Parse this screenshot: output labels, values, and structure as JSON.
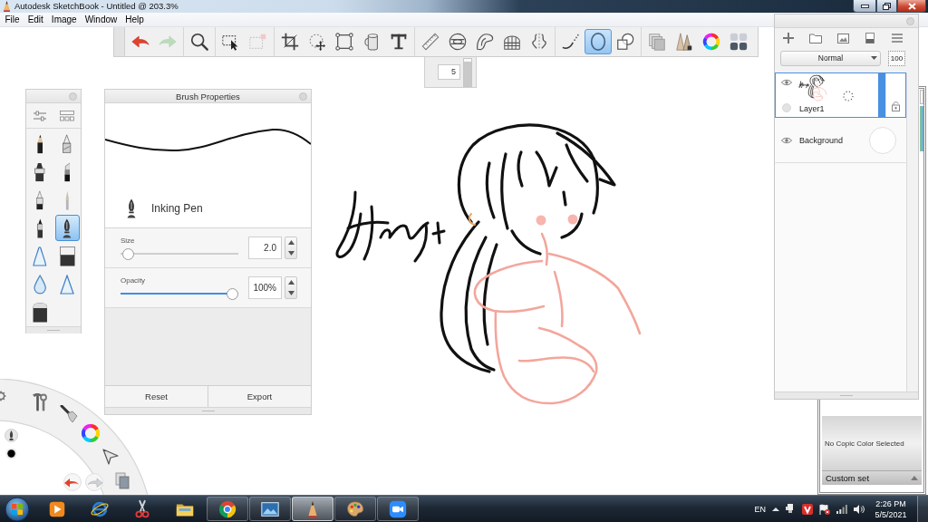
{
  "window": {
    "title": "Autodesk SketchBook - Untitled @ 203.3%"
  },
  "menu": [
    "File",
    "Edit",
    "Image",
    "Window",
    "Help"
  ],
  "toolbar": {
    "groups": [
      {
        "tools": [
          {
            "selected": false,
            "disabled": false
          },
          {
            "selected": false,
            "disabled": true
          }
        ]
      },
      {
        "tools": [
          {
            "selected": false,
            "disabled": false
          }
        ]
      },
      {
        "tools": [
          {
            "selected": false,
            "disabled": false
          },
          {
            "selected": false,
            "disabled": true
          }
        ]
      },
      {
        "tools": [
          {
            "selected": false,
            "disabled": false
          },
          {
            "selected": false,
            "disabled": false
          },
          {
            "selected": false,
            "disabled": false
          },
          {
            "selected": false,
            "disabled": false
          },
          {
            "selected": false,
            "disabled": false
          }
        ]
      },
      {
        "tools": [
          {
            "selected": false,
            "disabled": false
          },
          {
            "selected": false,
            "disabled": false
          },
          {
            "selected": false,
            "disabled": false
          },
          {
            "selected": false,
            "disabled": false
          },
          {
            "selected": false,
            "disabled": false
          }
        ]
      },
      {
        "tools": [
          {
            "selected": false,
            "disabled": false
          },
          {
            "selected": true,
            "disabled": false
          },
          {
            "selected": false,
            "disabled": false
          }
        ]
      },
      {
        "tools": [
          {
            "selected": false,
            "disabled": false
          },
          {
            "selected": false,
            "disabled": false
          },
          {
            "selected": false,
            "disabled": false
          },
          {
            "selected": false,
            "disabled": false
          }
        ]
      }
    ]
  },
  "size_widget": {
    "value": "5",
    "level": 0.9
  },
  "brush_palette": {
    "brushes": [
      {
        "selected": false
      },
      {
        "selected": false
      },
      {
        "selected": false
      },
      {
        "selected": false
      },
      {
        "selected": false
      },
      {
        "selected": false
      },
      {
        "selected": false
      },
      {
        "selected": true
      },
      {
        "selected": false
      },
      {
        "selected": false
      },
      {
        "selected": false
      },
      {
        "selected": false
      },
      {
        "selected": false
      }
    ]
  },
  "brush_properties": {
    "title": "Brush Properties",
    "brush_name": "Inking Pen",
    "sliders": [
      {
        "label": "Size",
        "value": "2.0",
        "level": 0.02
      },
      {
        "label": "Opacity",
        "value": "100%",
        "level": 1
      }
    ],
    "buttons": [
      "Reset",
      "Export"
    ]
  },
  "layers": {
    "blend_mode": "Normal",
    "opacity": "100",
    "items": [
      {
        "kind": "paint",
        "name": "Layer1",
        "selected": true,
        "visible": true
      },
      {
        "kind": "background",
        "name": "Background",
        "selected": false,
        "visible": true
      }
    ]
  },
  "copic": {
    "message": "No Copic Color Selected",
    "set": "Custom set"
  },
  "taskbar": {
    "apps": [
      {
        "running": false,
        "selected": false
      },
      {
        "running": false,
        "selected": false
      },
      {
        "running": false,
        "selected": false
      },
      {
        "running": false,
        "selected": false
      },
      {
        "running": true,
        "selected": false
      },
      {
        "running": true,
        "selected": false
      },
      {
        "running": true,
        "selected": true
      },
      {
        "running": true,
        "selected": false
      },
      {
        "running": true,
        "selected": false
      }
    ],
    "tray": {
      "language": "EN",
      "time": "2:26 PM",
      "date": "5/5/2021"
    }
  }
}
